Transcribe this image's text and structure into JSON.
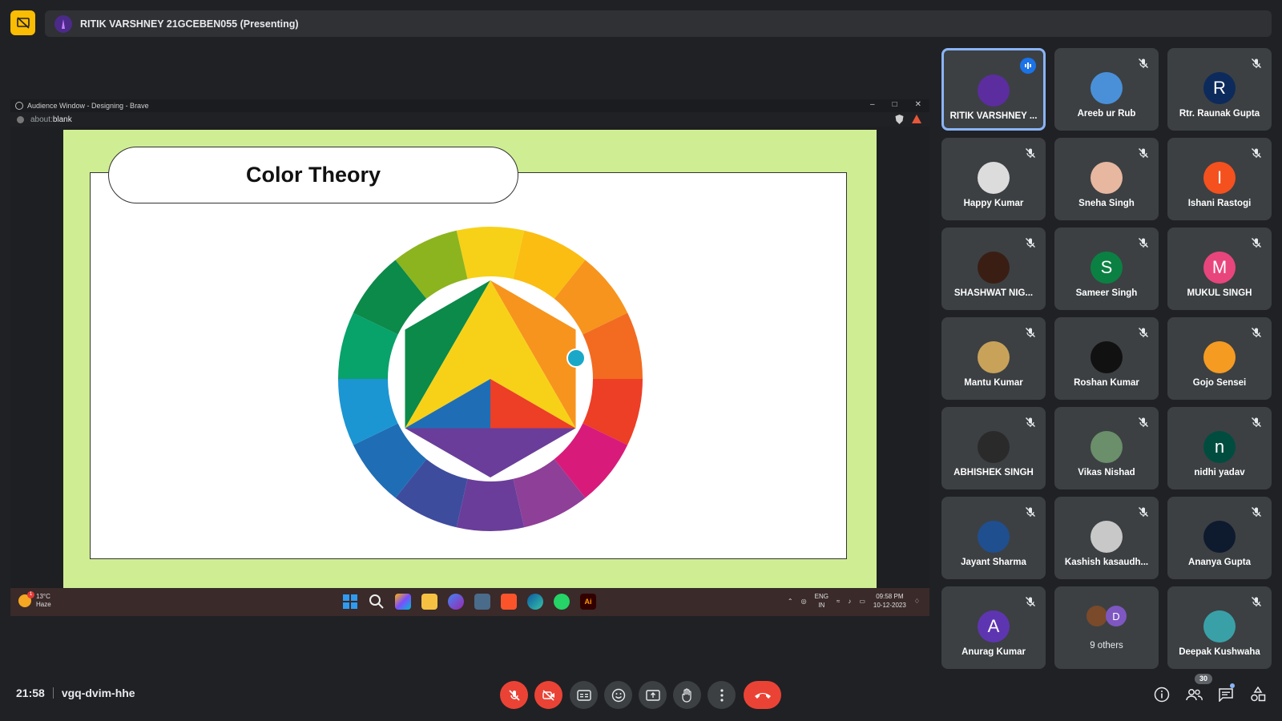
{
  "presenting": {
    "label": "RITIK VARSHNEY 21GCEBEN055 (Presenting)"
  },
  "shared_window": {
    "title": "Audience Window - Designing - Brave",
    "address_prefix": "about:",
    "address_host": "blank",
    "slide_title": "Color Theory"
  },
  "taskbar": {
    "temperature": "13°C",
    "weather": "Haze",
    "weather_badge": "1",
    "lang_line1": "ENG",
    "lang_line2": "IN",
    "time": "09:58 PM",
    "date": "10-12-2023",
    "apps": [
      "windows-start",
      "search",
      "widgets",
      "file-explorer",
      "copilot",
      "photos",
      "brave",
      "edge",
      "whatsapp",
      "adobe-illustrator"
    ]
  },
  "participants": [
    {
      "name": "RITIK VARSHNEY ...",
      "initial": "",
      "color": "#5b2d9e",
      "speaking": true
    },
    {
      "name": "Areeb ur Rub",
      "initial": "",
      "color": "#4a90d9",
      "speaking": false
    },
    {
      "name": "Rtr. Raunak Gupta",
      "initial": "R",
      "color": "#0d2a5c",
      "speaking": false
    },
    {
      "name": "Happy Kumar",
      "initial": "",
      "color": "#dcdcdc",
      "speaking": false
    },
    {
      "name": "Sneha Singh",
      "initial": "",
      "color": "#e8b7a0",
      "speaking": false
    },
    {
      "name": "Ishani Rastogi",
      "initial": "I",
      "color": "#f4511e",
      "speaking": false
    },
    {
      "name": "SHASHWAT NIG...",
      "initial": "",
      "color": "#3a1e14",
      "speaking": false
    },
    {
      "name": "Sameer Singh",
      "initial": "S",
      "color": "#0b8043",
      "speaking": false
    },
    {
      "name": "MUKUL SINGH",
      "initial": "M",
      "color": "#e8457c",
      "speaking": false
    },
    {
      "name": "Mantu Kumar",
      "initial": "",
      "color": "#c9a25a",
      "speaking": false
    },
    {
      "name": "Roshan Kumar",
      "initial": "",
      "color": "#111111",
      "speaking": false
    },
    {
      "name": "Gojo Sensei",
      "initial": "",
      "color": "#f59b22",
      "speaking": false
    },
    {
      "name": "ABHISHEK SINGH",
      "initial": "",
      "color": "#2a2a2a",
      "speaking": false
    },
    {
      "name": "Vikas Nishad",
      "initial": "",
      "color": "#6a8f6a",
      "speaking": false
    },
    {
      "name": "nidhi yadav",
      "initial": "n",
      "color": "#004d40",
      "speaking": false
    },
    {
      "name": "Jayant Sharma",
      "initial": "",
      "color": "#1f4f8f",
      "speaking": false
    },
    {
      "name": "Kashish kasaudh...",
      "initial": "",
      "color": "#c8c8c8",
      "speaking": false
    },
    {
      "name": "Ananya Gupta",
      "initial": "",
      "color": "#0e1a2e",
      "speaking": false
    },
    {
      "name": "Anurag Kumar",
      "initial": "A",
      "color": "#5e35b1",
      "speaking": false
    },
    {
      "name": "Deepak Kushwaha",
      "initial": "",
      "color": "#3aa0a8",
      "speaking": false
    }
  ],
  "others": {
    "label": "9 others",
    "second_initial": "D"
  },
  "meeting": {
    "time": "21:58",
    "code": "vgq-dvim-hhe",
    "participant_count": "30"
  },
  "controls": [
    "mic-off",
    "camera-off",
    "captions",
    "emoji",
    "present",
    "raise-hand",
    "more-options",
    "leave-call"
  ],
  "colors": {
    "danger": "#ea4335",
    "accent": "#8ab4f8",
    "slide_bg": "#cfee93"
  }
}
